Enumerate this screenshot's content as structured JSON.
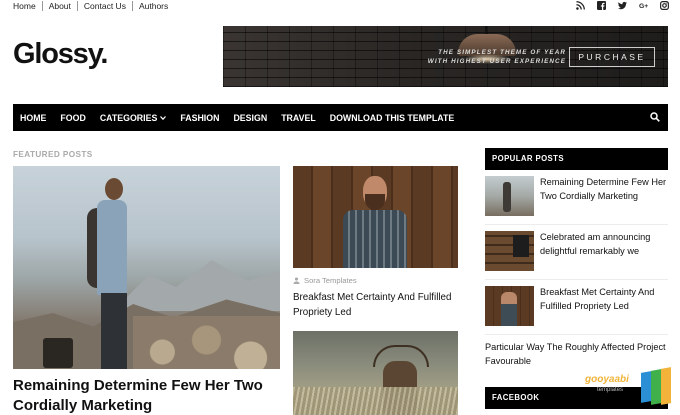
{
  "topbar": {
    "links": [
      "Home",
      "About",
      "Contact Us",
      "Authors"
    ],
    "social_icons": [
      "rss-icon",
      "facebook-icon",
      "twitter-icon",
      "google-plus-icon",
      "instagram-icon"
    ]
  },
  "header": {
    "logo": "Glossy.",
    "banner": {
      "tagline_1": "THE SIMPLEST THEME OF YEAR",
      "tagline_2": "WITH HIGHEST USER EXPERIENCE",
      "button": "PURCHASE"
    }
  },
  "nav": {
    "items": [
      "HOME",
      "FOOD",
      "CATEGORIES",
      "FASHION",
      "DESIGN",
      "TRAVEL",
      "DOWNLOAD THIS TEMPLATE"
    ]
  },
  "featured": {
    "label": "FEATURED POSTS",
    "main_title": "Remaining Determine Few Her Two Cordially Marketing",
    "second_author": "Sora Templates",
    "second_title": "Breakfast Met Certainty And Fulfilled Propriety Led"
  },
  "sidebar": {
    "popular_heading": "POPULAR POSTS",
    "popular": [
      "Remaining Determine Few Her Two Cordially Marketing",
      "Celebrated am announcing delightful remarkably we",
      "Breakfast Met Certainty And Fulfilled Propriety Led",
      "Particular Way The Roughly Affected Project Favourable"
    ],
    "facebook_heading": "FACEBOOK"
  },
  "watermark": {
    "text": "gooyaabi",
    "sub": "templates"
  }
}
